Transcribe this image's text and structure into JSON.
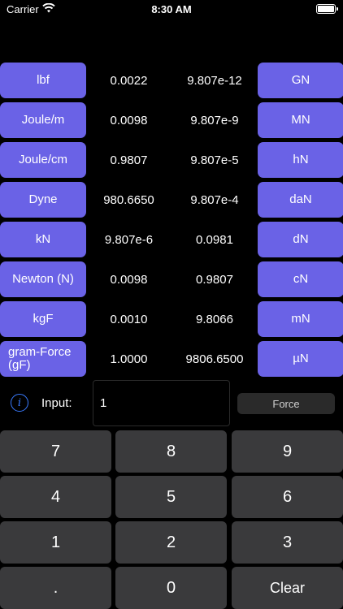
{
  "status_bar": {
    "carrier": "Carrier",
    "time": "8:30 AM"
  },
  "rows": [
    {
      "left": "lbf",
      "value_a": "0.0022",
      "value_b": "9.807e-12",
      "right": "GN"
    },
    {
      "left": "Joule/m",
      "value_a": "0.0098",
      "value_b": "9.807e-9",
      "right": "MN"
    },
    {
      "left": "Joule/cm",
      "value_a": "0.9807",
      "value_b": "9.807e-5",
      "right": "hN"
    },
    {
      "left": "Dyne",
      "value_a": "980.6650",
      "value_b": "9.807e-4",
      "right": "daN"
    },
    {
      "left": "kN",
      "value_a": "9.807e-6",
      "value_b": "0.0981",
      "right": "dN"
    },
    {
      "left": "Newton (N)",
      "value_a": "0.0098",
      "value_b": "0.9807",
      "right": "cN"
    },
    {
      "left": "kgF",
      "value_a": "0.0010",
      "value_b": "9.8066",
      "right": "mN"
    },
    {
      "left": "gram-Force (gF)",
      "value_a": "1.0000",
      "value_b": "9806.6500",
      "right": "µN"
    }
  ],
  "input": {
    "label": "Input:",
    "value": "1",
    "category_button": "Force",
    "info_icon": "info-icon"
  },
  "keypad": [
    "7",
    "8",
    "9",
    "4",
    "5",
    "6",
    "1",
    "2",
    "3",
    ".",
    "0",
    "Clear"
  ],
  "colors": {
    "unit_button": "#6a62e6",
    "key": "#3a3a3c",
    "accent": "#3a7bff",
    "background": "#000000"
  }
}
